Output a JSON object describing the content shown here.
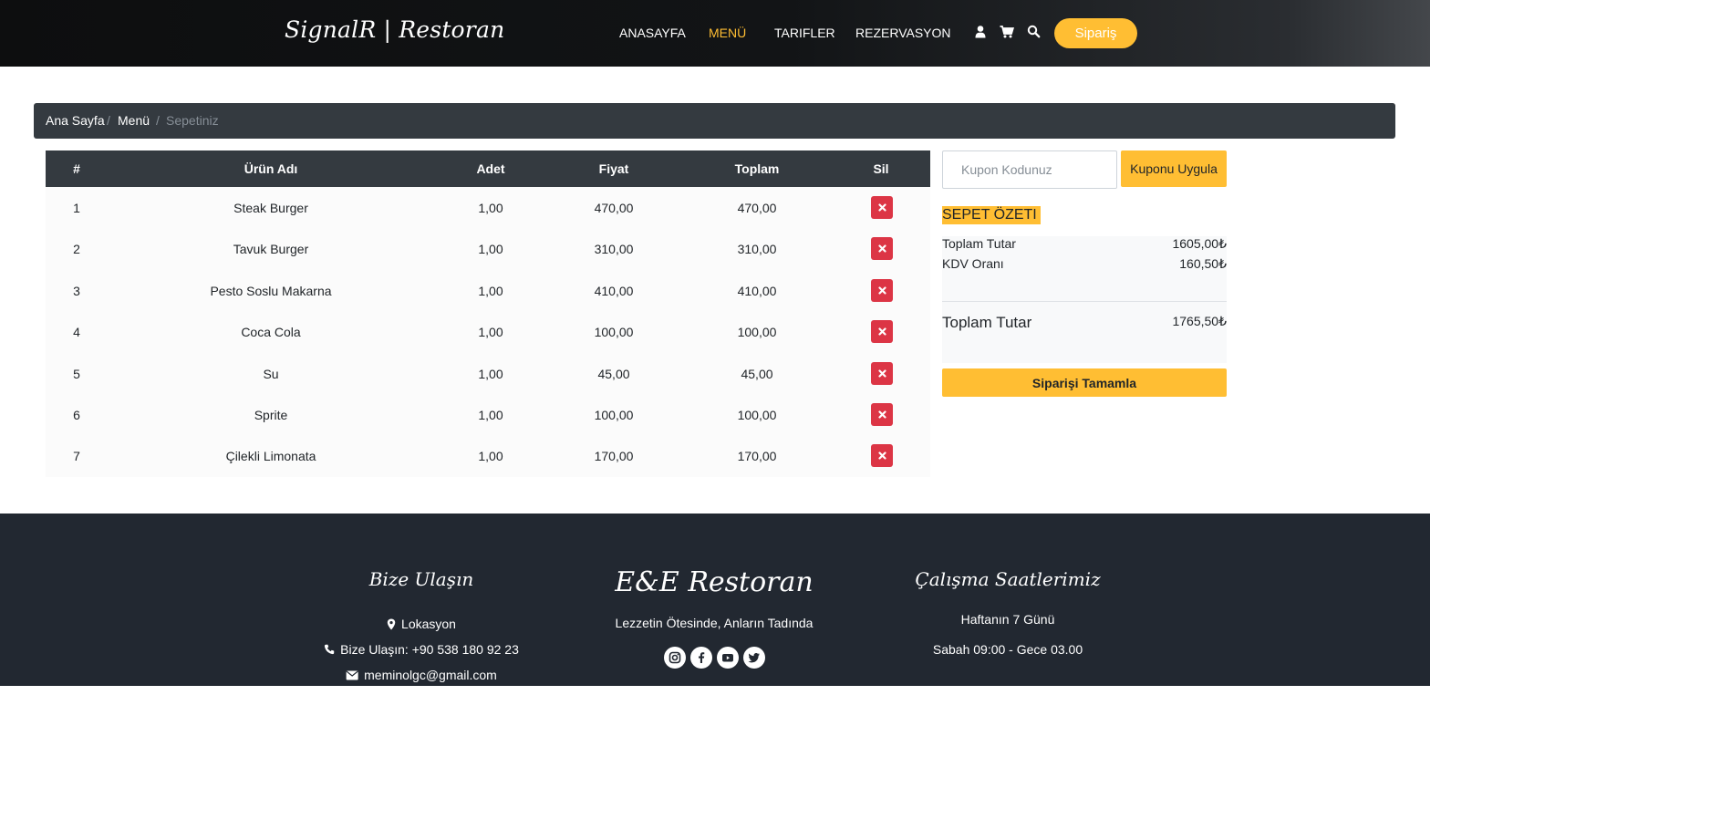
{
  "header": {
    "logo": "SignalR | Restoran",
    "nav": [
      "ANASAYFA",
      "MENÜ",
      "TARIFLER",
      "REZERVASYON"
    ],
    "active_nav": "MENÜ",
    "icons": [
      "user-icon",
      "cart-icon",
      "search-icon"
    ],
    "order_button": "Sipariş"
  },
  "breadcrumb": {
    "items": [
      "Ana Sayfa",
      "Menü",
      "Sepetiniz"
    ],
    "separator": "/"
  },
  "table": {
    "headers": [
      "#",
      "Ürün Adı",
      "Adet",
      "Fiyat",
      "Toplam",
      "Sil"
    ],
    "rows": [
      {
        "no": "1",
        "name": "Steak Burger",
        "qty": "1,00",
        "price": "470,00",
        "total": "470,00"
      },
      {
        "no": "2",
        "name": "Tavuk Burger",
        "qty": "1,00",
        "price": "310,00",
        "total": "310,00"
      },
      {
        "no": "3",
        "name": "Pesto Soslu Makarna",
        "qty": "1,00",
        "price": "410,00",
        "total": "410,00"
      },
      {
        "no": "4",
        "name": "Coca Cola",
        "qty": "1,00",
        "price": "100,00",
        "total": "100,00"
      },
      {
        "no": "5",
        "name": "Su",
        "qty": "1,00",
        "price": "45,00",
        "total": "45,00"
      },
      {
        "no": "6",
        "name": "Sprite",
        "qty": "1,00",
        "price": "100,00",
        "total": "100,00"
      },
      {
        "no": "7",
        "name": "Çilekli Limonata",
        "qty": "1,00",
        "price": "170,00",
        "total": "170,00"
      }
    ]
  },
  "coupon": {
    "placeholder": "Kupon Kodunuz",
    "button": "Kuponu Uygula"
  },
  "summary": {
    "title": "SEPET ÖZETI",
    "subtotal_label": "Toplam Tutar",
    "subtotal_value": "1605,00₺",
    "vat_label": "KDV Oranı",
    "vat_value": "160,50₺",
    "total_label": "Toplam Tutar",
    "total_value": "1765,50₺",
    "complete_button": "Siparişi Tamamla"
  },
  "footer": {
    "contact_title": "Bize Ulaşın",
    "location": "Lokasyon",
    "phone": "Bize Ulaşın: +90 538 180 92 23",
    "email": "meminolgc@gmail.com",
    "brand_title": "E&E Restoran",
    "slogan": "Lezzetin Ötesinde, Anların Tadında",
    "social_icons": [
      "instagram-icon",
      "facebook-icon",
      "youtube-icon",
      "twitter-icon"
    ],
    "hours_title": "Çalışma Saatlerimiz",
    "days": "Haftanın 7 Günü",
    "hours": "Sabah 09:00 - Gece 03.00"
  },
  "colors": {
    "accent": "#ffbe33",
    "dark": "#343a40",
    "footer": "#222831",
    "danger": "#dc3545"
  }
}
